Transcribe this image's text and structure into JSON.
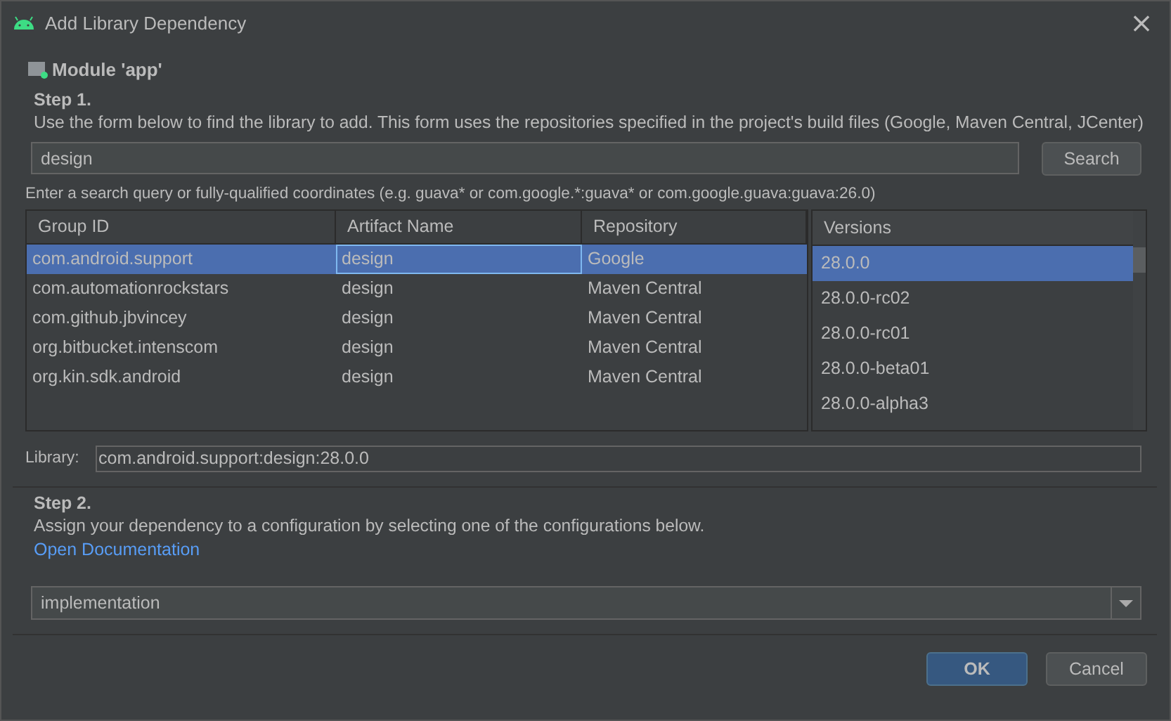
{
  "window": {
    "title": "Add Library Dependency",
    "close": "×"
  },
  "module": {
    "label": "Module 'app'"
  },
  "step1": {
    "heading": "Step 1.",
    "description": "Use the form below to find the library to add. This form uses the repositories specified in the project's build files (Google, Maven Central, JCenter)"
  },
  "search": {
    "value": "design",
    "button": "Search",
    "hint": "Enter a search query or fully-qualified coordinates (e.g. guava* or com.google.*:guava* or com.google.guava:guava:26.0)"
  },
  "table": {
    "columns": [
      "Group ID",
      "Artifact Name",
      "Repository"
    ],
    "rows": [
      {
        "cells": [
          "com.android.support",
          "design",
          "Google"
        ],
        "selected": true
      },
      {
        "cells": [
          "com.automationrockstars",
          "design",
          "Maven Central"
        ],
        "selected": false
      },
      {
        "cells": [
          "com.github.jbvincey",
          "design",
          "Maven Central"
        ],
        "selected": false
      },
      {
        "cells": [
          "org.bitbucket.intenscom",
          "design",
          "Maven Central"
        ],
        "selected": false
      },
      {
        "cells": [
          "org.kin.sdk.android",
          "design",
          "Maven Central"
        ],
        "selected": false
      }
    ]
  },
  "versions": {
    "heading": "Versions",
    "items": [
      {
        "label": "28.0.0",
        "selected": true
      },
      {
        "label": "28.0.0-rc02",
        "selected": false
      },
      {
        "label": "28.0.0-rc01",
        "selected": false
      },
      {
        "label": "28.0.0-beta01",
        "selected": false
      },
      {
        "label": "28.0.0-alpha3",
        "selected": false
      }
    ]
  },
  "library": {
    "label": "Library:",
    "value": "com.android.support:design:28.0.0"
  },
  "step2": {
    "heading": "Step 2.",
    "description": "Assign your dependency to a configuration by selecting one of the configurations below.",
    "link": "Open Documentation"
  },
  "configuration": {
    "value": "implementation"
  },
  "buttons": [
    {
      "label": "OK",
      "kind": "primary"
    },
    {
      "label": "Cancel",
      "kind": "secondary"
    }
  ]
}
